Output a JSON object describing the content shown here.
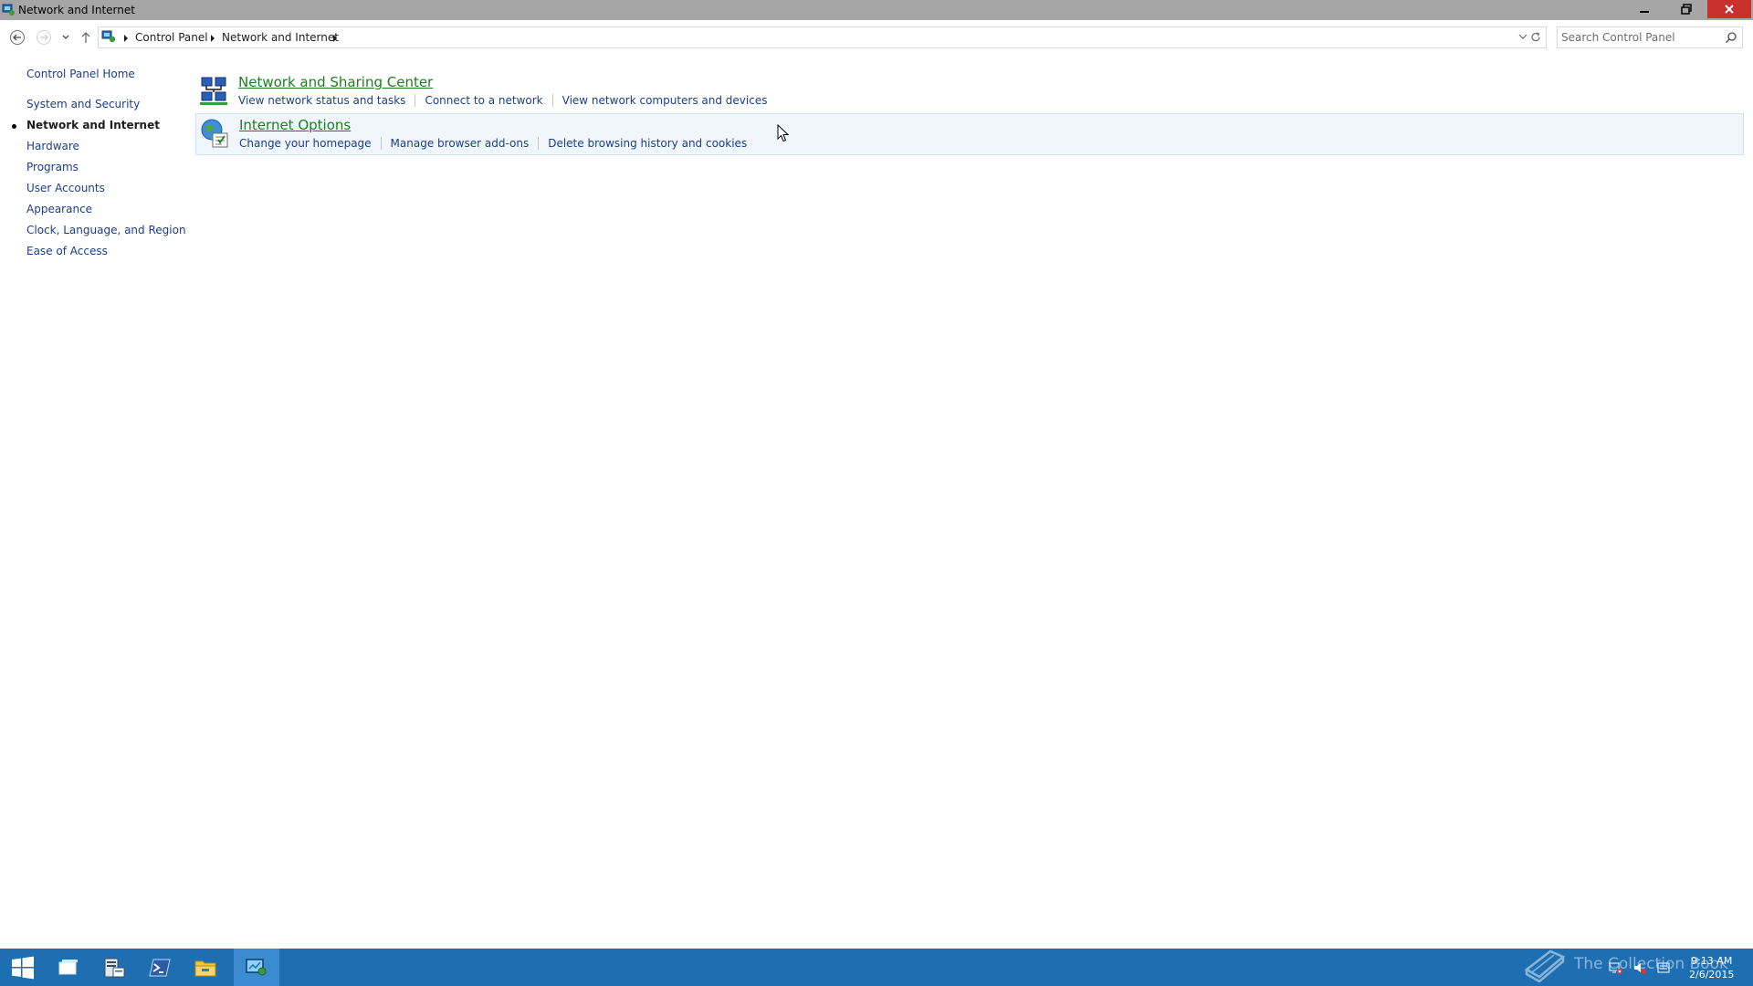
{
  "window": {
    "title": "Network and Internet",
    "controls": [
      "minimize",
      "restore",
      "close"
    ]
  },
  "navigation": {
    "back_icon": "arrow-left-icon",
    "forward_icon": "arrow-right-icon",
    "recent_icon": "chevron-down-icon",
    "up_icon": "arrow-up-icon"
  },
  "address_bar": {
    "breadcrumbs": [
      "Control Panel",
      "Network and Internet"
    ]
  },
  "search": {
    "placeholder": "Search Control Panel"
  },
  "sidebar": {
    "home": "Control Panel Home",
    "items": [
      {
        "label": "System and Security",
        "current": false
      },
      {
        "label": "Network and Internet",
        "current": true
      },
      {
        "label": "Hardware",
        "current": false
      },
      {
        "label": "Programs",
        "current": false
      },
      {
        "label": "User Accounts",
        "current": false
      },
      {
        "label": "Appearance",
        "current": false
      },
      {
        "label": "Clock, Language, and Region",
        "current": false
      },
      {
        "label": "Ease of Access",
        "current": false
      }
    ]
  },
  "categories": [
    {
      "title": "Network and Sharing Center",
      "icon": "network-sharing-icon",
      "links": [
        "View network status and tasks",
        "Connect to a network",
        "View network computers and devices"
      ]
    },
    {
      "title": "Internet Options",
      "icon": "internet-options-icon",
      "links": [
        "Change your homepage",
        "Manage browser add-ons",
        "Delete browsing history and cookies"
      ]
    }
  ],
  "taskbar": {
    "apps": [
      "start-icon",
      "task-view-icon",
      "server-manager-icon",
      "powershell-icon",
      "file-explorer-icon",
      "control-panel-icon"
    ],
    "watermark": "The Collection Book",
    "clock": {
      "time": "9:13 AM",
      "date": "2/6/2015"
    }
  },
  "colors": {
    "titlebar": "#a6a6a6",
    "close_button": "#c7302b",
    "link": "#1a3e8c",
    "category_title": "#1d7e21",
    "taskbar": "#1d6fb1"
  }
}
